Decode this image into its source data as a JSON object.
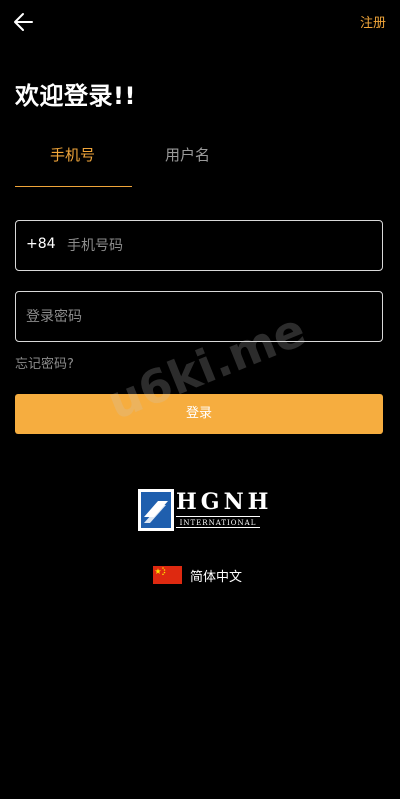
{
  "header": {
    "back_icon": "arrow-left-icon",
    "register_label": "注册"
  },
  "welcome_title": "欢迎登录!!",
  "tabs": [
    {
      "label": "手机号",
      "active": true
    },
    {
      "label": "用户名",
      "active": false
    }
  ],
  "phone_field": {
    "country_code": "+84",
    "placeholder": "手机号码",
    "value": ""
  },
  "password_field": {
    "placeholder": "登录密码",
    "value": ""
  },
  "forgot_label": "忘记密码?",
  "login_label": "登录",
  "logo": {
    "text": "HGNH",
    "subtitle": "INTERNATIONAL"
  },
  "language": {
    "flag_icon": "china-flag-icon",
    "label": "简体中文"
  },
  "watermark": "u6ki.me",
  "colors": {
    "accent": "#f0a53a",
    "button": "#f6ad3f",
    "background": "#000000",
    "muted_text": "#8c8c8c"
  }
}
